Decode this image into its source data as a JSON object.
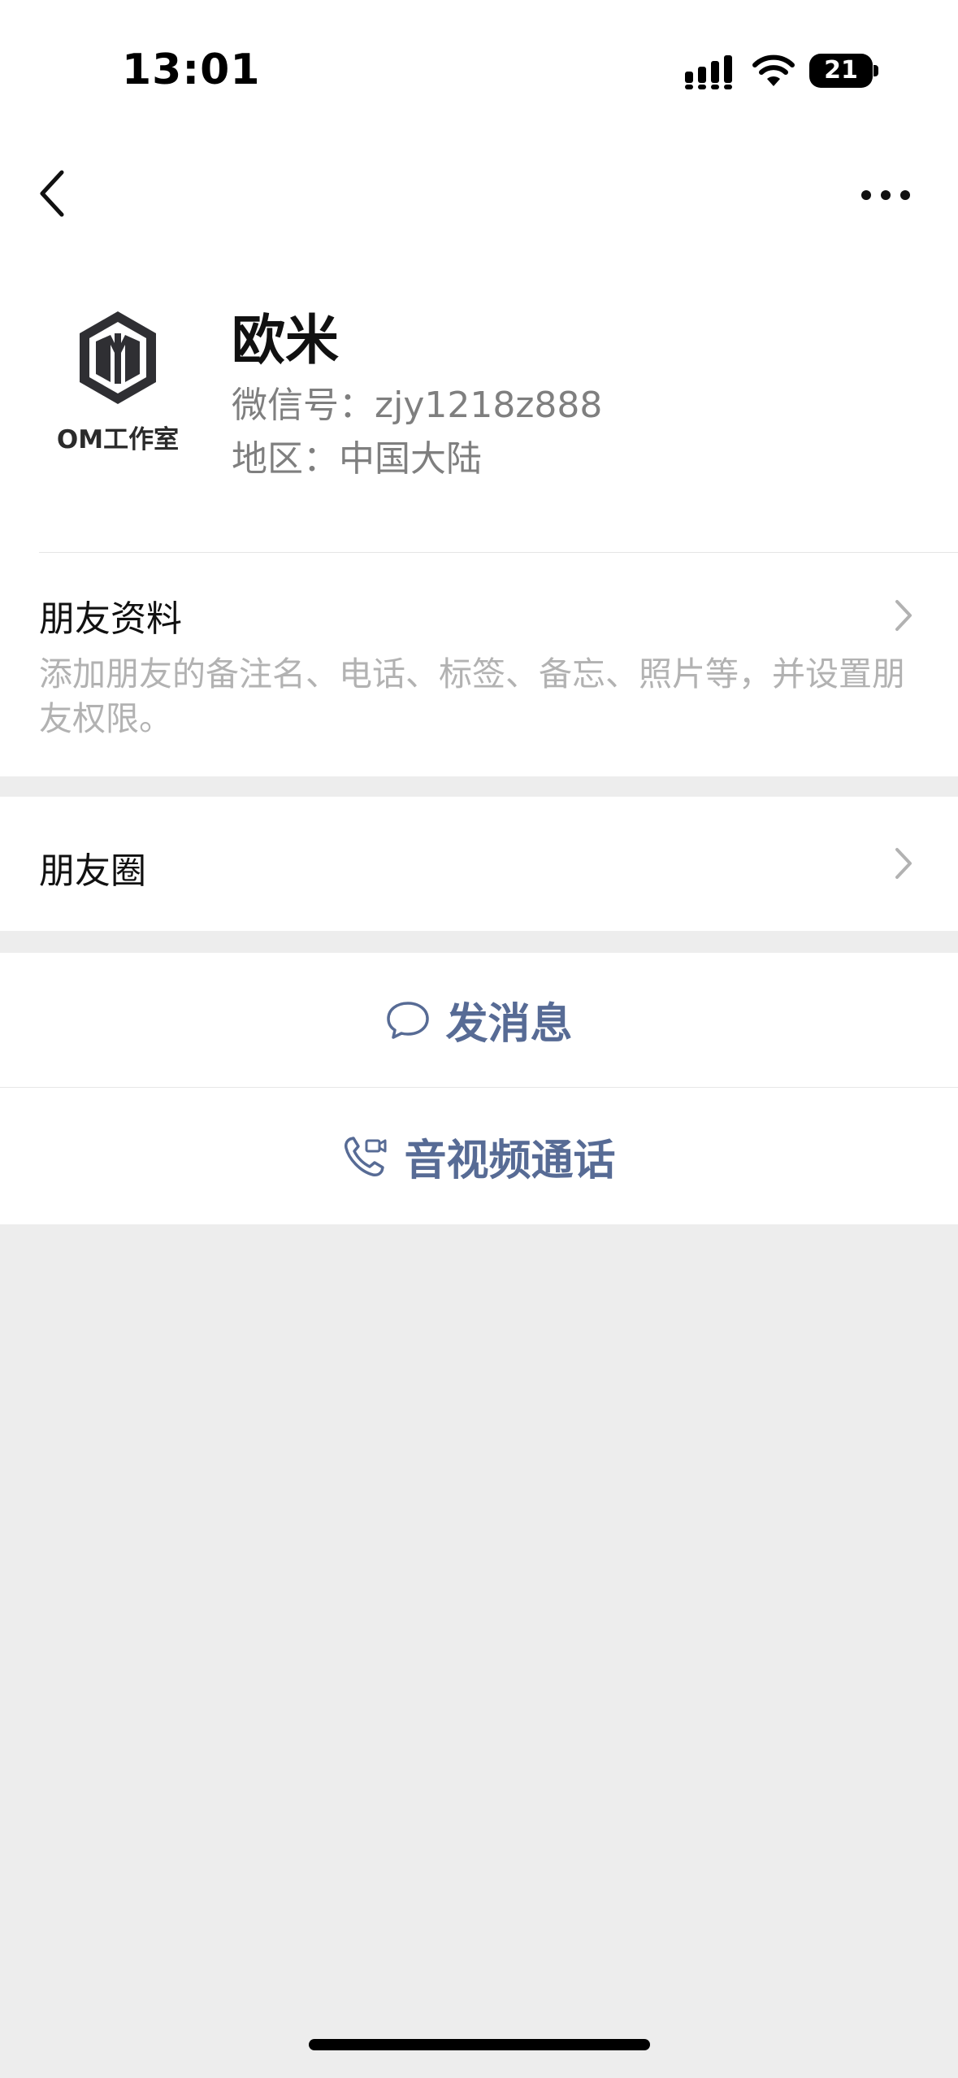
{
  "status_bar": {
    "time": "13:01",
    "battery": "21",
    "icons": [
      "signal-icon",
      "wifi-icon",
      "battery-icon"
    ]
  },
  "nav": {
    "back_icon": "chevron-left-icon",
    "more_icon": "more-dots-icon"
  },
  "profile": {
    "avatar_text": "OM工作室",
    "name": "欧米",
    "wechat_id": "微信号：zjy1218z888",
    "region": "地区：中国大陆"
  },
  "friend_info": {
    "title": "朋友资料",
    "description": "添加朋友的备注名、电话、标签、备忘、照片等，并设置朋友权限。"
  },
  "moments": {
    "title": "朋友圈"
  },
  "actions": {
    "send_message": "发消息",
    "call": "音视频通话",
    "accent_color": "#576b95"
  }
}
